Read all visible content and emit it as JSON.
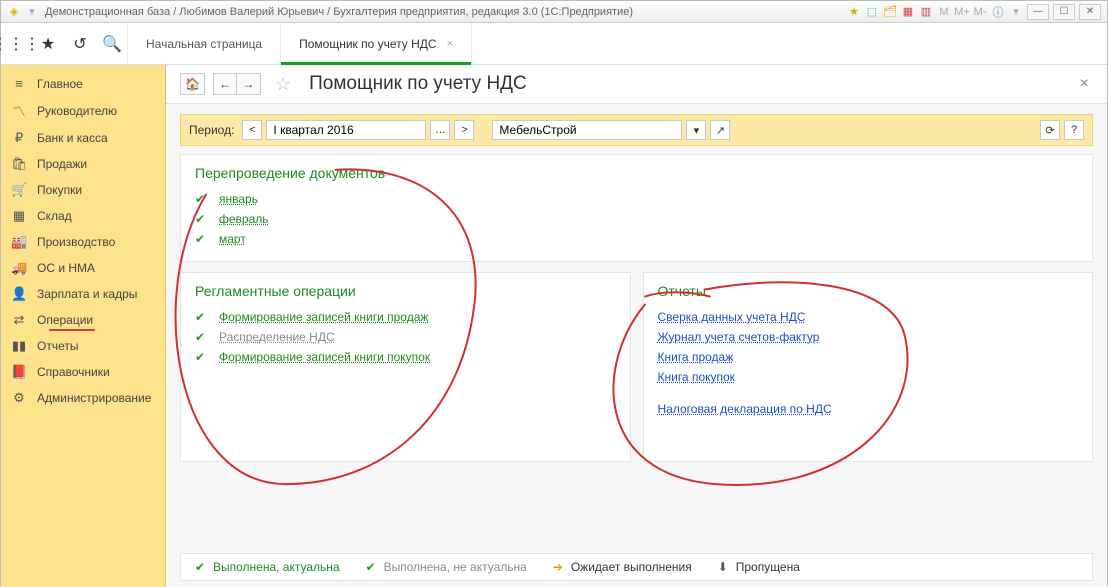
{
  "titlebar": {
    "title": "Демонстрационная база / Любимов Валерий Юрьевич / Бухгалтерия предприятия, редакция 3.0  (1С:Предприятие)"
  },
  "tabs": {
    "home": "Начальная страница",
    "active": "Помощник по учету НДС"
  },
  "sidebar": {
    "main": "Главное",
    "manager": "Руководителю",
    "bank": "Банк и касса",
    "sales": "Продажи",
    "purchases": "Покупки",
    "warehouse": "Склад",
    "production": "Производство",
    "assets": "ОС и НМА",
    "salary": "Зарплата и кадры",
    "operations": "Операции",
    "reports": "Отчеты",
    "directories": "Справочники",
    "admin": "Администрирование"
  },
  "page": {
    "title": "Помощник по учету НДС"
  },
  "period": {
    "label": "Период:",
    "value": "I квартал 2016",
    "org": "МебельСтрой"
  },
  "section1": {
    "title": "Перепроведение документов",
    "m1": "январь",
    "m2": "февраль",
    "m3": "март"
  },
  "section2": {
    "title": "Регламентные операции",
    "op1": "Формирование записей книги продаж",
    "op2": "Распределение НДС",
    "op3": "Формирование записей книги покупок"
  },
  "section3": {
    "title": "Отчеты",
    "r1": "Сверка данных учета НДС",
    "r2": "Журнал учета счетов-фактур",
    "r3": "Книга продаж",
    "r4": "Книга покупок",
    "r5": "Налоговая декларация по НДС"
  },
  "legend": {
    "l1": "Выполнена, актуальна",
    "l2": "Выполнена, не актуальна",
    "l3": "Ожидает выполнения",
    "l4": "Пропущена"
  }
}
